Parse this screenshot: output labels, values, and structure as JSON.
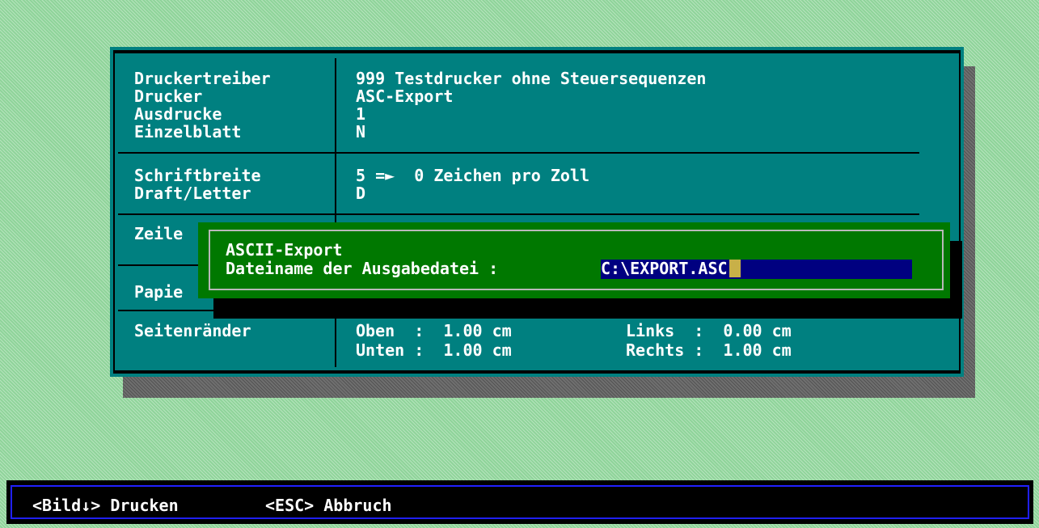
{
  "settings": {
    "driver_label": "Druckertreiber",
    "driver_value": "999 Testdrucker ohne Steuersequenzen",
    "printer_label": "Drucker",
    "printer_value": "ASC-Export",
    "copies_label": "Ausdrucke",
    "copies_value": "1",
    "single_sheet_label": "Einzelblatt",
    "single_sheet_value": "N",
    "font_width_label": "Schriftbreite",
    "font_width_value": "5 =►  0 Zeichen pro Zoll",
    "draft_letter_label": "Draft/Letter",
    "draft_letter_value": "D",
    "lines_label": "Zeile",
    "paper_label": "Papie",
    "margins_label": "Seitenränder",
    "margin_top": "Oben  :  1.00 cm",
    "margin_bottom": "Unten :  1.00 cm",
    "margin_left": "Links  :  0.00 cm",
    "margin_right": "Rechts :  1.00 cm"
  },
  "dialog": {
    "title": "ASCII-Export",
    "prompt": "Dateiname der Ausgabedatei :",
    "filename_value": "C:\\EXPORT.ASC"
  },
  "statusbar": {
    "print_key": "<Bild↓> Drucken",
    "cancel_key": "<ESC> Abbruch"
  },
  "colors": {
    "panel": "#008080",
    "dialog": "#007800",
    "input": "#000080",
    "cursor": "#c8b048"
  }
}
